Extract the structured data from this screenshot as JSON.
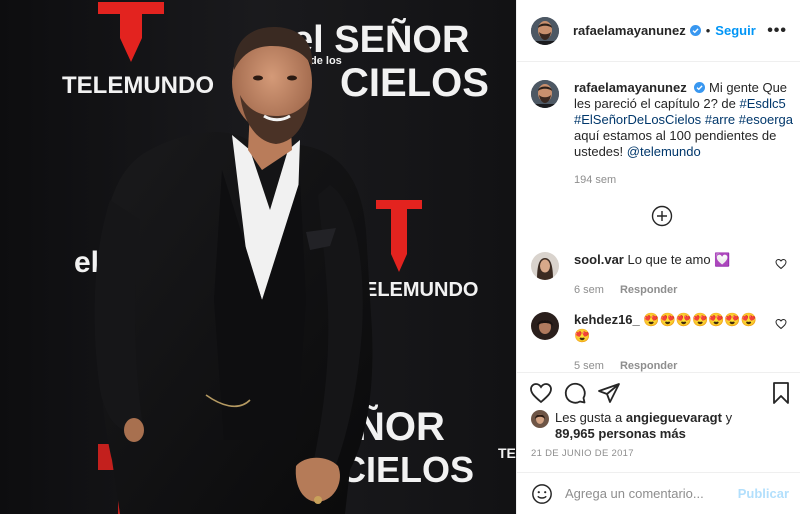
{
  "photo": {
    "wall_text": {
      "telemundo": "TELEMUNDO",
      "telemundo_cut": "ELEMUNDO",
      "el_senor": "el SEÑOR",
      "de_los": "de los",
      "cielos": "CIELOS",
      "senor_lower": "ÑOR",
      "cielos_lower": "CIELOS",
      "el_fragment": "el",
      "te_fragment": "TE"
    },
    "colors": {
      "backdrop": "#121214",
      "logo_red": "#e3231f"
    }
  },
  "post": {
    "author": "rafaelamayanunez",
    "separator": "•",
    "follow_label": "Seguir",
    "more_label": "•••",
    "caption": {
      "username": "rafaelamayanunez",
      "text_1": "Mi gente Que les pareció el capítulo 2? de",
      "tag_1": "#Esdlc5",
      "tag_2": "#ElSeñorDeLosCielos",
      "tag_3": "#arre",
      "tag_4": "#esoerga",
      "text_2": "aquí estamos al 100 pendientes de ustedes!",
      "mention": "@telemundo",
      "time": "194 sem"
    },
    "comments": [
      {
        "username": "sool.var",
        "text": "Lo que te amo",
        "emoji": "💟",
        "time": "6 sem",
        "reply_label": "Responder"
      },
      {
        "username": "kehdez16_",
        "text": "",
        "emoji": "😍😍😍😍😍😍😍😍",
        "time": "5 sem",
        "reply_label": "Responder"
      }
    ],
    "likes": {
      "prefix": "Les gusta a",
      "user": "angieguevaragt",
      "connector": "y",
      "count": "89,965 personas más"
    },
    "date": "21 DE JUNIO DE 2017",
    "comment_box": {
      "placeholder": "Agrega un comentario...",
      "publish_label": "Publicar"
    },
    "colors": {
      "accent": "#0095f6",
      "link": "#00376b",
      "muted": "#8e8e8e",
      "publish_disabled": "#b2dffc"
    }
  }
}
